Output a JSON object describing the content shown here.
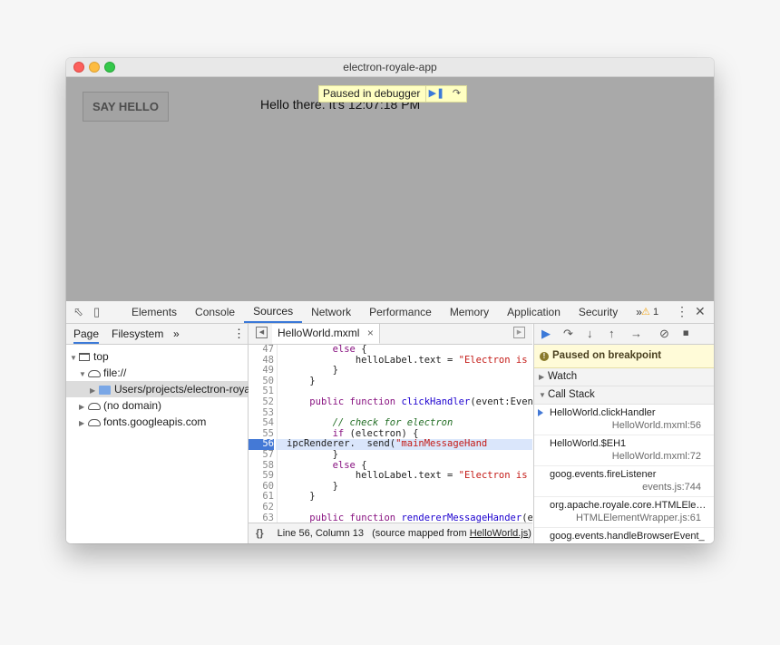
{
  "window": {
    "title": "electron-royale-app"
  },
  "app": {
    "button_label": "SAY HELLO",
    "hello_text": "Hello there. It's 12:07:18 PM",
    "paused_label": "Paused in debugger"
  },
  "devtools": {
    "tabs": [
      "Elements",
      "Console",
      "Sources",
      "Network",
      "Performance",
      "Memory",
      "Application",
      "Security"
    ],
    "active_tab": "Sources",
    "more_tabs": "»",
    "warning_count": "1",
    "navigator": {
      "tabs": [
        "Page",
        "Filesystem"
      ],
      "more": "»",
      "tree": {
        "top": "top",
        "file": "file://",
        "folder": "Users/projects/electron-royale",
        "no_domain": "(no domain)",
        "fonts": "fonts.googleapis.com"
      }
    },
    "editor": {
      "file_tab": "HelloWorld.mxml",
      "close": "×",
      "lines": [
        {
          "n": "47",
          "html": "        <span class=\"kw\">else</span> {"
        },
        {
          "n": "48",
          "html": "            helloLabel.text = <span class=\"str\">\"Electron is not f</span>"
        },
        {
          "n": "49",
          "html": "        }"
        },
        {
          "n": "50",
          "html": "    }"
        },
        {
          "n": "51",
          "html": ""
        },
        {
          "n": "52",
          "html": "    <span class=\"kw\">public function</span> <span class=\"fn\">clickHandler</span>(event:Event):"
        },
        {
          "n": "53",
          "html": ""
        },
        {
          "n": "54",
          "html": "        <span class=\"cm\">// check for electron</span>"
        },
        {
          "n": "55",
          "html": "        <span class=\"kw\">if</span> (electron) {"
        },
        {
          "n": "56",
          "html": "ipcRenderer.  send(<span class=\"str\">\"mainMessageHand</span>",
          "bp": true
        },
        {
          "n": "57",
          "html": "        }"
        },
        {
          "n": "58",
          "html": "        <span class=\"kw\">else</span> {"
        },
        {
          "n": "59",
          "html": "            helloLabel.text = <span class=\"str\">\"Electron is not f</span>"
        },
        {
          "n": "60",
          "html": "        }"
        },
        {
          "n": "61",
          "html": "    }"
        },
        {
          "n": "62",
          "html": ""
        },
        {
          "n": "63",
          "html": "    <span class=\"kw\">public function</span> <span class=\"fn\">rendererMessageHander</span>(even"
        }
      ],
      "status_braces": "{}",
      "status_position": "Line 56, Column 13",
      "status_mapped_prefix": "(source mapped from ",
      "status_mapped_file": "HelloWorld.js",
      "status_mapped_suffix": ")"
    },
    "debugger": {
      "notice": "Paused on breakpoint",
      "watch": "Watch",
      "call_stack": "Call Stack",
      "frames": [
        {
          "name": "HelloWorld.clickHandler",
          "loc": "HelloWorld.mxml:56",
          "current": true
        },
        {
          "name": "HelloWorld.$EH1",
          "loc": "HelloWorld.mxml:72"
        },
        {
          "name": "goog.events.fireListener",
          "loc": "events.js:744"
        },
        {
          "name": "org.apache.royale.core.HTMLEle…",
          "loc": "HTMLElementWrapper.js:61"
        },
        {
          "name": "goog.events.handleBrowserEvent_",
          "loc": "events.js:870"
        }
      ]
    }
  }
}
